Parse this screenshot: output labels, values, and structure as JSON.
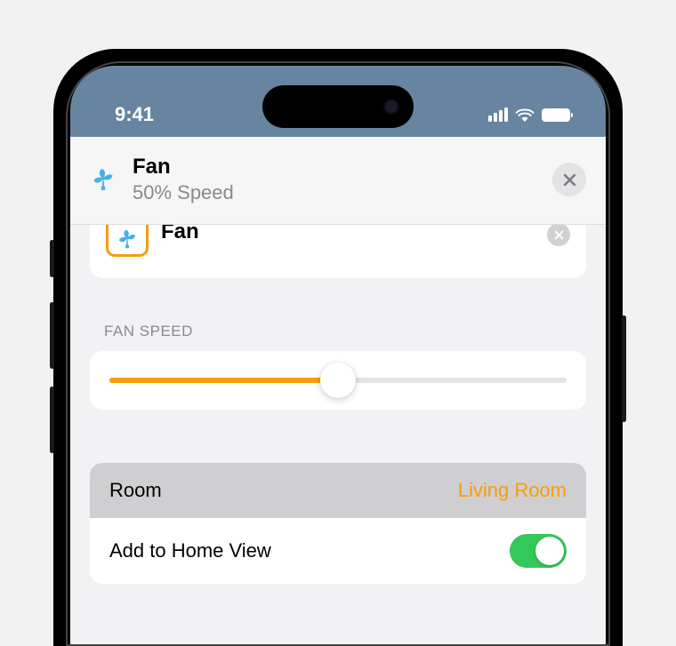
{
  "status": {
    "time": "9:41"
  },
  "sheet": {
    "title": "Fan",
    "subtitle": "50% Speed"
  },
  "peek": {
    "title": "Fan"
  },
  "speed": {
    "section_label": "FAN SPEED",
    "percent": 50
  },
  "settings": {
    "room_label": "Room",
    "room_value": "Living Room",
    "home_view_label": "Add to Home View",
    "home_view_on": true
  },
  "colors": {
    "accent": "#f59e0b",
    "toggle_on": "#34c759"
  }
}
